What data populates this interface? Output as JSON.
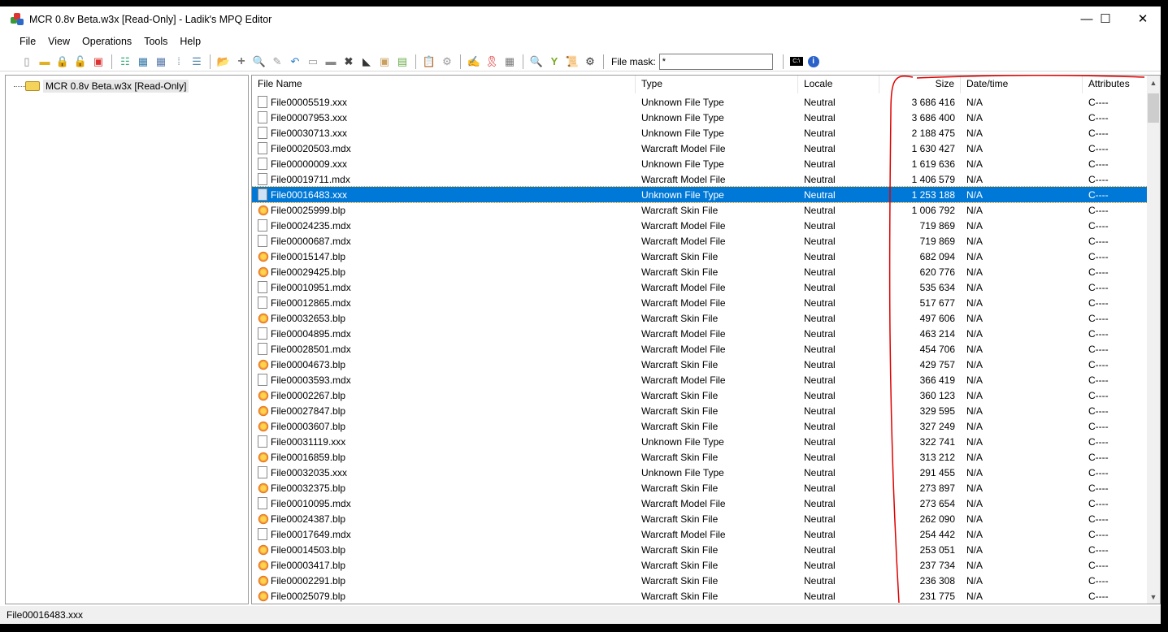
{
  "window": {
    "title": "MCR 0.8v Beta.w3x [Read-Only] - Ladik's MPQ Editor",
    "minimize": "—",
    "maximize": "☐",
    "close": "✕"
  },
  "menu": [
    "File",
    "View",
    "Operations",
    "Tools",
    "Help"
  ],
  "toolbar": {
    "file_mask_label": "File mask:",
    "file_mask_value": "*"
  },
  "tree": {
    "root": "MCR 0.8v Beta.w3x [Read-Only]"
  },
  "columns": [
    "File Name",
    "Type",
    "Locale",
    "Size",
    "Date/time",
    "Attributes"
  ],
  "selected_index": 6,
  "rows": [
    [
      "File00005519.xxx",
      "Unknown File Type",
      "Neutral",
      "3 686 416",
      "N/A",
      "C----",
      "doc"
    ],
    [
      "File00007953.xxx",
      "Unknown File Type",
      "Neutral",
      "3 686 400",
      "N/A",
      "C----",
      "doc"
    ],
    [
      "File00030713.xxx",
      "Unknown File Type",
      "Neutral",
      "2 188 475",
      "N/A",
      "C----",
      "doc"
    ],
    [
      "File00020503.mdx",
      "Warcraft Model File",
      "Neutral",
      "1 630 427",
      "N/A",
      "C----",
      "doc"
    ],
    [
      "File00000009.xxx",
      "Unknown File Type",
      "Neutral",
      "1 619 636",
      "N/A",
      "C----",
      "doc"
    ],
    [
      "File00019711.mdx",
      "Warcraft Model File",
      "Neutral",
      "1 406 579",
      "N/A",
      "C----",
      "doc"
    ],
    [
      "File00016483.xxx",
      "Unknown File Type",
      "Neutral",
      "1 253 188",
      "N/A",
      "C----",
      "doc"
    ],
    [
      "File00025999.blp",
      "Warcraft Skin File",
      "Neutral",
      "1 006 792",
      "N/A",
      "C----",
      "blp"
    ],
    [
      "File00024235.mdx",
      "Warcraft Model File",
      "Neutral",
      "719 869",
      "N/A",
      "C----",
      "doc"
    ],
    [
      "File00000687.mdx",
      "Warcraft Model File",
      "Neutral",
      "719 869",
      "N/A",
      "C----",
      "doc"
    ],
    [
      "File00015147.blp",
      "Warcraft Skin File",
      "Neutral",
      "682 094",
      "N/A",
      "C----",
      "blp"
    ],
    [
      "File00029425.blp",
      "Warcraft Skin File",
      "Neutral",
      "620 776",
      "N/A",
      "C----",
      "blp"
    ],
    [
      "File00010951.mdx",
      "Warcraft Model File",
      "Neutral",
      "535 634",
      "N/A",
      "C----",
      "doc"
    ],
    [
      "File00012865.mdx",
      "Warcraft Model File",
      "Neutral",
      "517 677",
      "N/A",
      "C----",
      "doc"
    ],
    [
      "File00032653.blp",
      "Warcraft Skin File",
      "Neutral",
      "497 606",
      "N/A",
      "C----",
      "blp"
    ],
    [
      "File00004895.mdx",
      "Warcraft Model File",
      "Neutral",
      "463 214",
      "N/A",
      "C----",
      "doc"
    ],
    [
      "File00028501.mdx",
      "Warcraft Model File",
      "Neutral",
      "454 706",
      "N/A",
      "C----",
      "doc"
    ],
    [
      "File00004673.blp",
      "Warcraft Skin File",
      "Neutral",
      "429 757",
      "N/A",
      "C----",
      "blp"
    ],
    [
      "File00003593.mdx",
      "Warcraft Model File",
      "Neutral",
      "366 419",
      "N/A",
      "C----",
      "doc"
    ],
    [
      "File00002267.blp",
      "Warcraft Skin File",
      "Neutral",
      "360 123",
      "N/A",
      "C----",
      "blp"
    ],
    [
      "File00027847.blp",
      "Warcraft Skin File",
      "Neutral",
      "329 595",
      "N/A",
      "C----",
      "blp"
    ],
    [
      "File00003607.blp",
      "Warcraft Skin File",
      "Neutral",
      "327 249",
      "N/A",
      "C----",
      "blp"
    ],
    [
      "File00031119.xxx",
      "Unknown File Type",
      "Neutral",
      "322 741",
      "N/A",
      "C----",
      "doc"
    ],
    [
      "File00016859.blp",
      "Warcraft Skin File",
      "Neutral",
      "313 212",
      "N/A",
      "C----",
      "blp"
    ],
    [
      "File00032035.xxx",
      "Unknown File Type",
      "Neutral",
      "291 455",
      "N/A",
      "C----",
      "doc"
    ],
    [
      "File00032375.blp",
      "Warcraft Skin File",
      "Neutral",
      "273 897",
      "N/A",
      "C----",
      "blp"
    ],
    [
      "File00010095.mdx",
      "Warcraft Model File",
      "Neutral",
      "273 654",
      "N/A",
      "C----",
      "doc"
    ],
    [
      "File00024387.blp",
      "Warcraft Skin File",
      "Neutral",
      "262 090",
      "N/A",
      "C----",
      "blp"
    ],
    [
      "File00017649.mdx",
      "Warcraft Model File",
      "Neutral",
      "254 442",
      "N/A",
      "C----",
      "doc"
    ],
    [
      "File00014503.blp",
      "Warcraft Skin File",
      "Neutral",
      "253 051",
      "N/A",
      "C----",
      "blp"
    ],
    [
      "File00003417.blp",
      "Warcraft Skin File",
      "Neutral",
      "237 734",
      "N/A",
      "C----",
      "blp"
    ],
    [
      "File00002291.blp",
      "Warcraft Skin File",
      "Neutral",
      "236 308",
      "N/A",
      "C----",
      "blp"
    ],
    [
      "File00025079.blp",
      "Warcraft Skin File",
      "Neutral",
      "231 775",
      "N/A",
      "C----",
      "blp"
    ]
  ],
  "status": "File00016483.xxx",
  "colors": {
    "selection": "#0078d7",
    "annotation": "#e00000"
  }
}
